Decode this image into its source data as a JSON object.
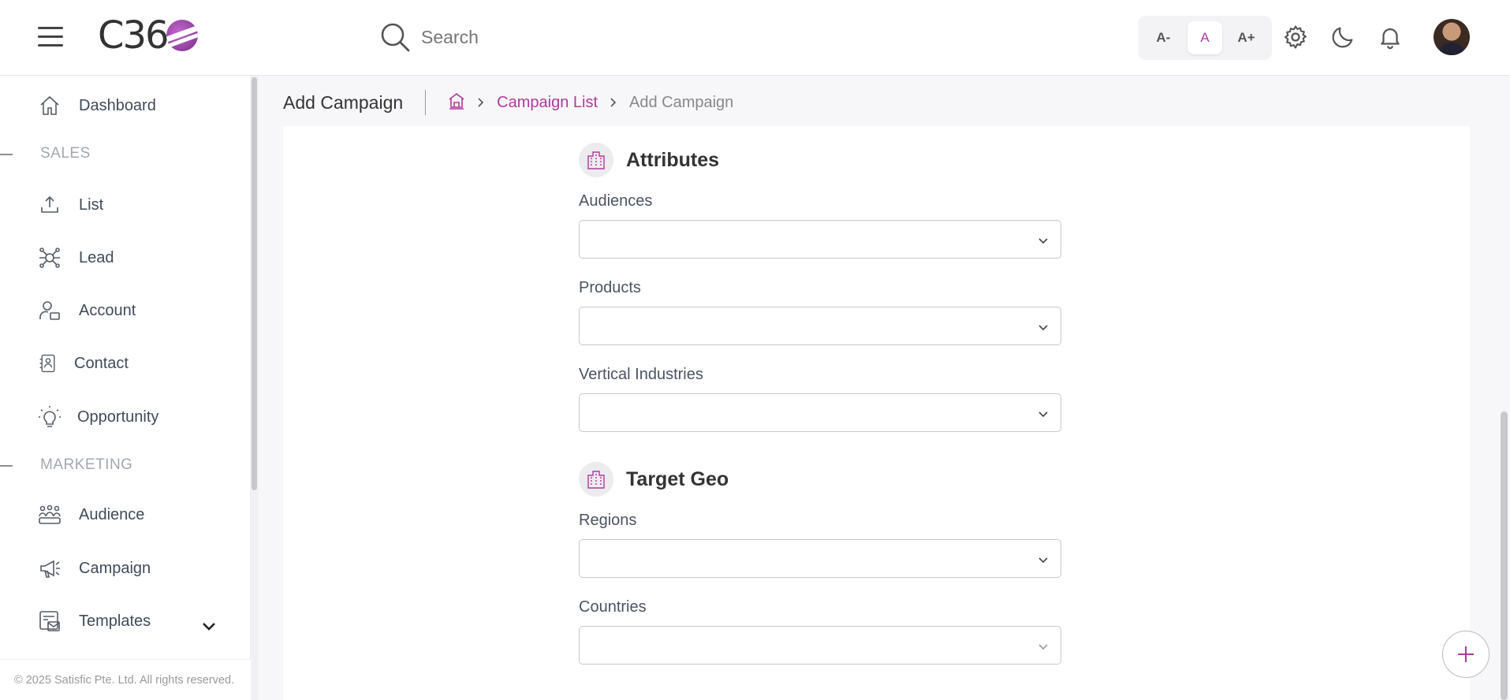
{
  "header": {
    "logo_text": "C36",
    "search_placeholder": "Search",
    "font_size_buttons": [
      "A-",
      "A",
      "A+"
    ],
    "active_font_size": "A"
  },
  "sidebar": {
    "items": [
      {
        "label": "Dashboard",
        "icon": "home-icon"
      },
      {
        "label": "List",
        "icon": "upload-icon"
      },
      {
        "label": "Lead",
        "icon": "network-icon"
      },
      {
        "label": "Account",
        "icon": "account-icon"
      },
      {
        "label": "Contact",
        "icon": "contact-icon"
      },
      {
        "label": "Opportunity",
        "icon": "lightbulb-icon"
      },
      {
        "label": "Audience",
        "icon": "group-icon"
      },
      {
        "label": "Campaign",
        "icon": "megaphone-icon"
      },
      {
        "label": "Templates",
        "icon": "template-icon"
      }
    ],
    "sections": [
      "SALES",
      "MARKETING"
    ],
    "footer": "© 2025 Satisfic Pte. Ltd. All rights reserved."
  },
  "page": {
    "title": "Add Campaign",
    "breadcrumb": {
      "link": "Campaign List",
      "current": "Add Campaign"
    }
  },
  "form": {
    "attributes": {
      "title": "Attributes",
      "fields": [
        "Audiences",
        "Products",
        "Vertical Industries"
      ]
    },
    "target_geo": {
      "title": "Target Geo",
      "fields": [
        "Regions",
        "Countries"
      ]
    }
  },
  "colors": {
    "accent": "#b0399d"
  }
}
